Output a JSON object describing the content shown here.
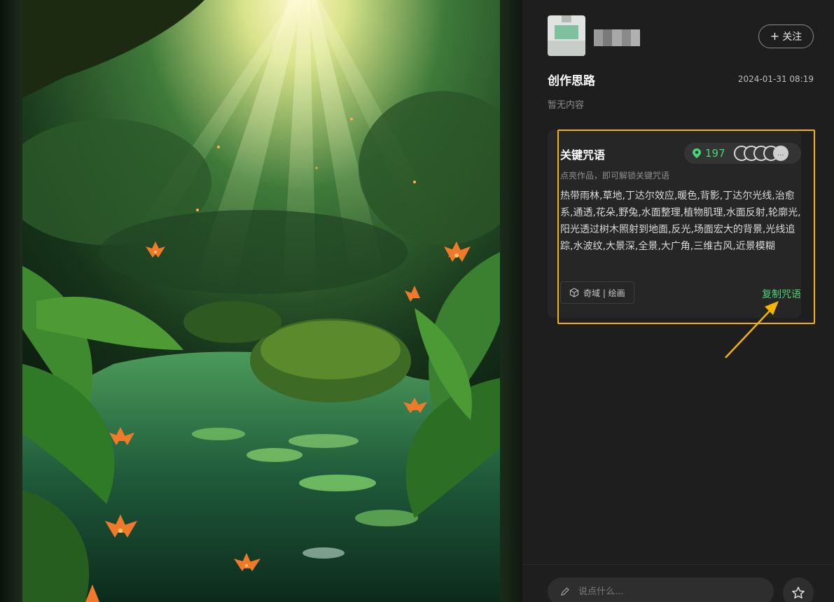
{
  "author": {
    "follow_label": "关注",
    "follow_icon": "plus-icon"
  },
  "post": {
    "section_title": "创作思路",
    "timestamp": "2024-01-31 08:19",
    "empty_text": "暂无内容"
  },
  "prompt_card": {
    "title": "关键咒语",
    "use_count": "197",
    "unlock_hint": "点亮作品，即可解锁关键咒语",
    "prompt_text": "热带雨林,草地,丁达尔效应,暖色,背影,丁达尔光线,治愈系,通透,花朵,野兔,水面整理,植物肌理,水面反射,轮廓光,阳光透过树木照射到地面,反光,场面宏大的背景,光线追踪,水波纹,大景深,全景,大广角,三维古风,近景模糊",
    "model_tag": "奇域 | 绘画",
    "copy_label": "复制咒语",
    "more_label": "…"
  },
  "comment": {
    "placeholder": "说点什么..."
  },
  "colors": {
    "accent_green": "#4ad477",
    "highlight": "#f4b400",
    "panel_bg": "#1e1e1e",
    "card_bg": "#262626"
  },
  "icons": {
    "pin": "location-pin-icon",
    "cube": "cube-icon",
    "pencil": "pencil-icon",
    "star": "star-icon"
  }
}
